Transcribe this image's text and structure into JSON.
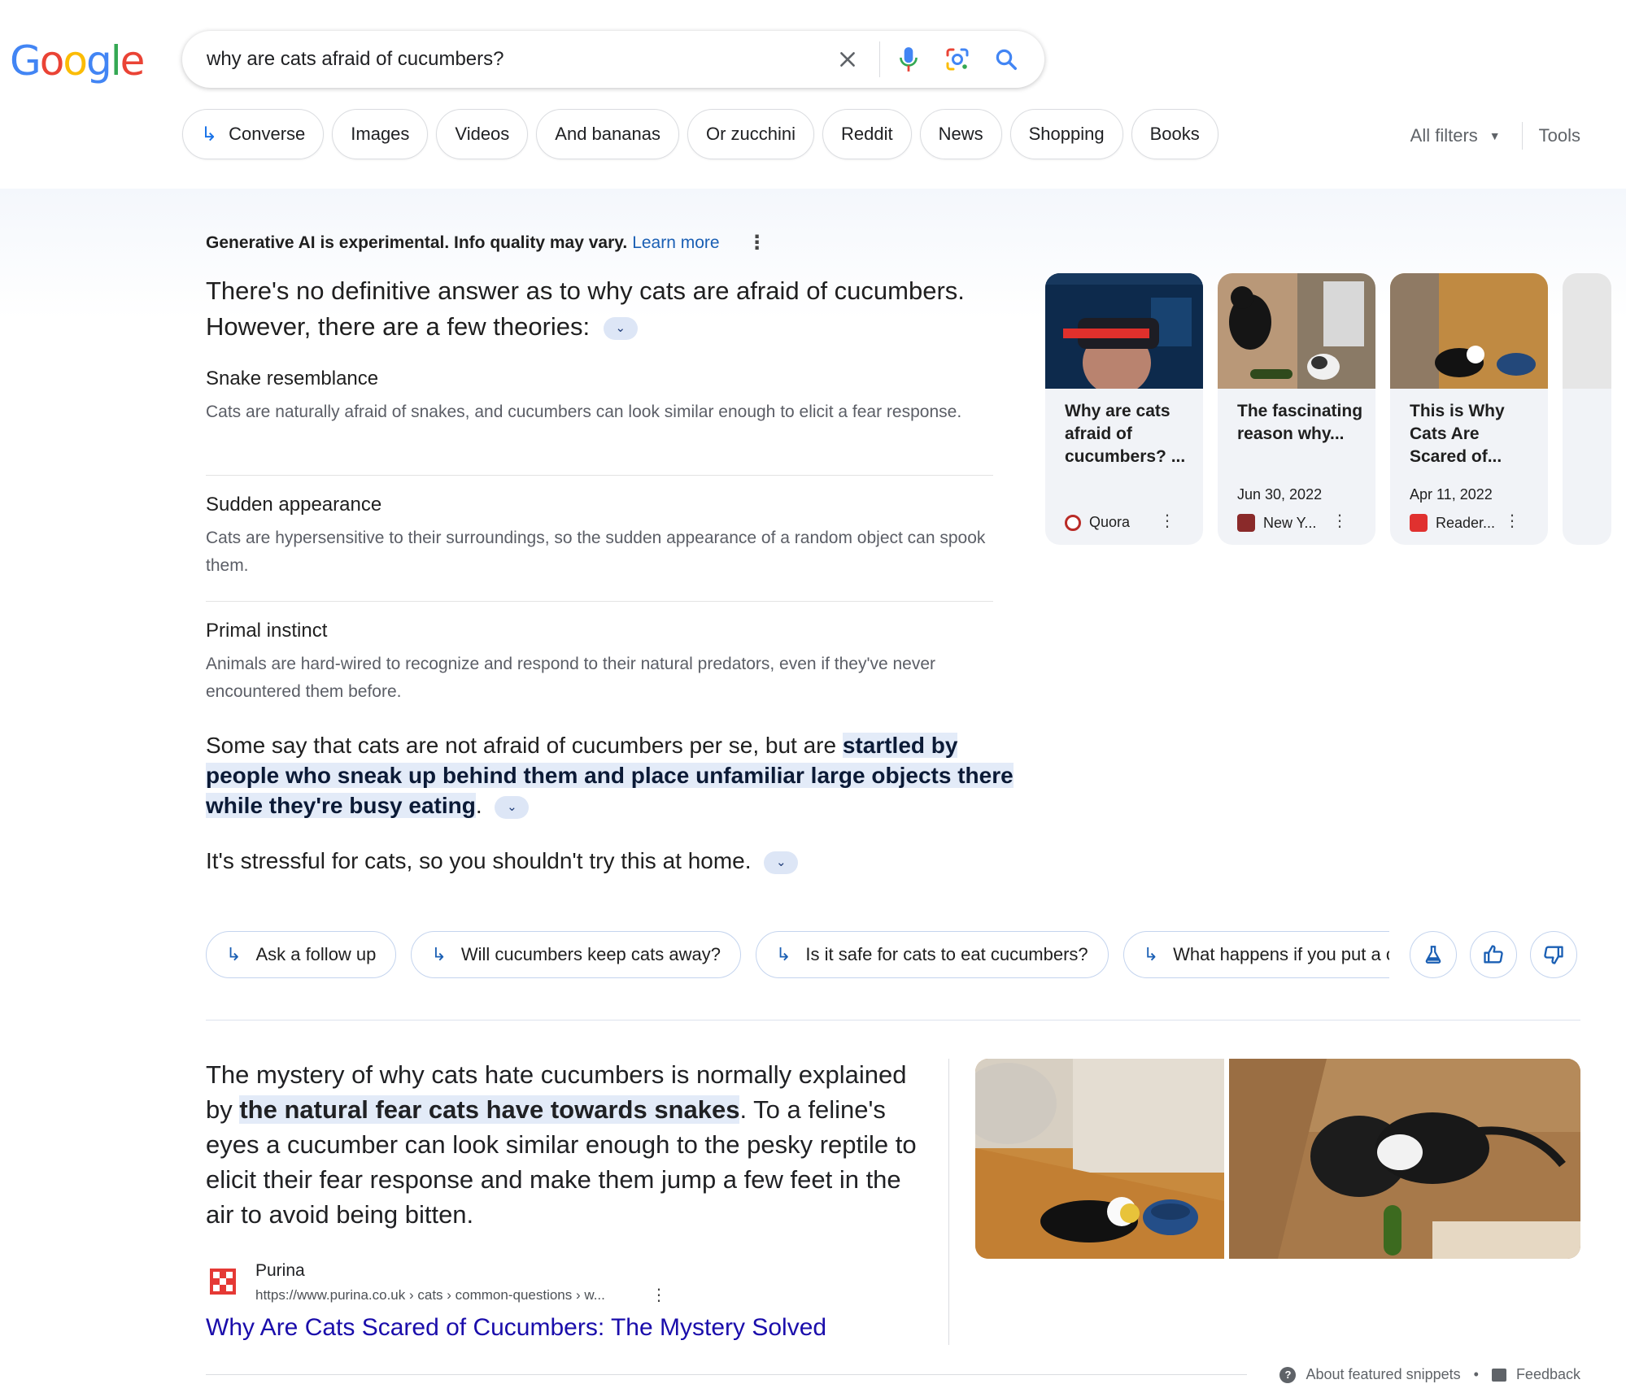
{
  "search": {
    "query": "why are cats afraid of cucumbers?"
  },
  "chips": [
    {
      "label": "Converse",
      "arrow": true
    },
    {
      "label": "Images"
    },
    {
      "label": "Videos"
    },
    {
      "label": "And bananas"
    },
    {
      "label": "Or zucchini"
    },
    {
      "label": "Reddit"
    },
    {
      "label": "News"
    },
    {
      "label": "Shopping"
    },
    {
      "label": "Books"
    }
  ],
  "filters": {
    "all_filters": "All filters",
    "tools": "Tools"
  },
  "ai": {
    "disclaimer": "Generative AI is experimental. Info quality may vary.",
    "learn_more": "Learn more",
    "lead_line1": "There's no definitive answer as to why cats are afraid of cucumbers.",
    "lead_line2": "However, there are a few theories:",
    "theories": [
      {
        "title": "Snake resemblance",
        "text": "Cats are naturally afraid of snakes, and cucumbers can look similar enough to elicit a fear response."
      },
      {
        "title": "Sudden appearance",
        "text": "Cats are hypersensitive to their surroundings, so the sudden appearance of a random object can spook them."
      },
      {
        "title": "Primal instinct",
        "text": "Animals are hard-wired to recognize and respond to their natural predators, even if they've never encountered them before."
      }
    ],
    "para1_plain": "Some say that cats are not afraid of cucumbers per se, but are ",
    "para1_bold": "startled by people who sneak up behind them and place unfamiliar large objects there while they're busy eating",
    "para1_end": ".",
    "para2": "It's stressful for cats, so you shouldn't try this at home."
  },
  "cards": [
    {
      "title": "Why are cats afraid of cucumbers? ...",
      "date": "",
      "source": "Quora",
      "fav_color": "#b92b27",
      "fav_glyph": "Q"
    },
    {
      "title": "The fascinating reason why...",
      "date": "Jun 30, 2022",
      "source": "New Y...",
      "fav_color": "#8a2a2a",
      "fav_glyph": "N"
    },
    {
      "title": "This is Why Cats Are Scared of...",
      "date": "Apr 11, 2022",
      "source": "Reader...",
      "fav_color": "#e0312f",
      "fav_glyph": "RD"
    }
  ],
  "followups": [
    "Ask a follow up",
    "Will cucumbers keep cats away?",
    "Is it safe for cats to eat cucumbers?",
    "What happens if you put a cu"
  ],
  "snippet": {
    "text_a": "The mystery of why cats hate cucumbers is normally explained by ",
    "text_bold": "the natural fear cats have towards snakes",
    "text_b": ". To a feline's eyes a cucumber can look similar enough to the pesky reptile to elicit their fear response and make them jump a few feet in the air to avoid being bitten.",
    "site_name": "Purina",
    "site_url": "https://www.purina.co.uk › cats › common-questions › w...",
    "link": "Why Are Cats Scared of Cucumbers: The Mystery Solved"
  },
  "footer": {
    "about": "About featured snippets",
    "dot": "•",
    "feedback": "Feedback"
  },
  "colors": {
    "accent": "#1a73e8",
    "link": "#1a0dab",
    "highlight": "#e3ebf8"
  }
}
